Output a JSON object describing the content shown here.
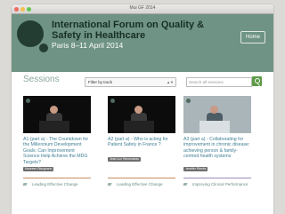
{
  "window": {
    "title": "Mui GF 2014"
  },
  "header": {
    "forum_title": "International Forum on Quality & Safety in Healthcare",
    "subtitle": "Paris 8–11 April 2014",
    "home_label": "Home"
  },
  "sessions": {
    "heading": "Sessions",
    "filter": "Filter by track",
    "search_placeholder": "Search all sessions"
  },
  "cards": [
    {
      "title": "A1 (part a) - The Countdown for the Millennium Development Goals: Can Improvement Science Help Achieve the MDG Targets?",
      "speaker": "Maureen Bisognano",
      "tag": "Leading Effective Change",
      "accent": "#c88c5e"
    },
    {
      "title": "A2 (part a) - Who is acting for Patient Safety in France ?",
      "speaker": "Jean-Luc Harousseau",
      "tag": "Leading Effective Change",
      "accent": "#c88c5e"
    },
    {
      "title": "A3 (part a) - Collaborating for improvement in chronic disease: achieving person & family-centred health systems",
      "speaker": "Jennifer Rienks",
      "tag": "Improving Clinical Performance",
      "accent": "#9a8cc0"
    }
  ],
  "colors": {
    "header_bg": "#6f9384",
    "logo": "#233d32",
    "link": "#3f7f94",
    "search_button": "#5c9b47"
  }
}
